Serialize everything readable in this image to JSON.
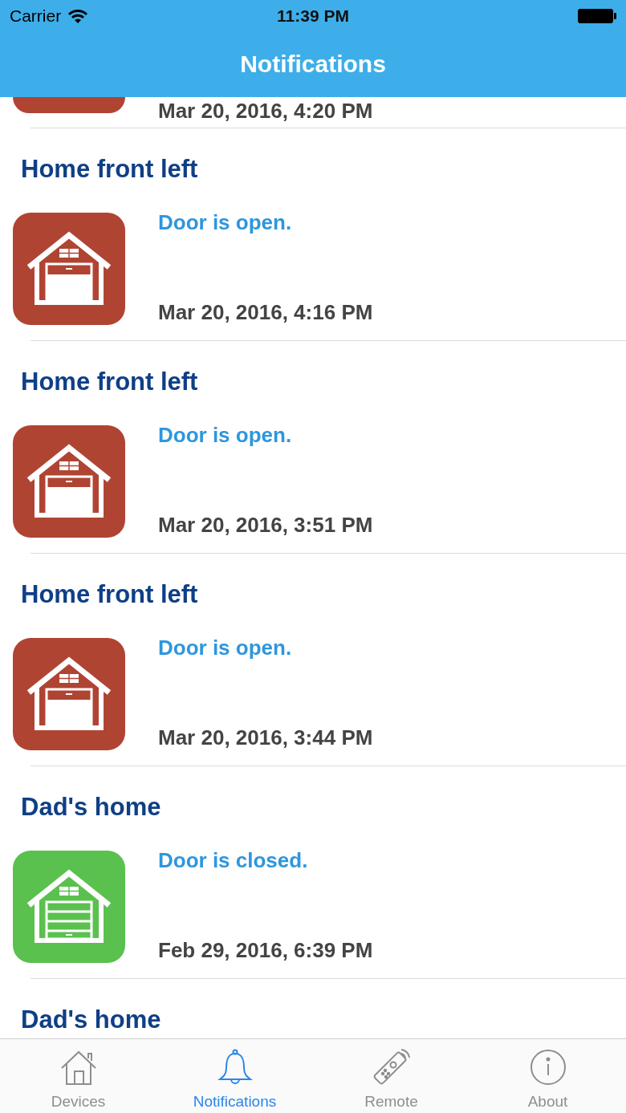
{
  "status_bar": {
    "carrier": "Carrier",
    "time": "11:39 PM"
  },
  "nav_bar": {
    "title": "Notifications"
  },
  "partial_item": {
    "date": "Mar 20, 2016, 4:20 PM",
    "door_open": true
  },
  "notifications": [
    {
      "title": "Home front left",
      "message": "Door is open.",
      "date": "Mar 20, 2016, 4:16 PM",
      "door_open": true
    },
    {
      "title": "Home front left",
      "message": "Door is open.",
      "date": "Mar 20, 2016, 3:51 PM",
      "door_open": true
    },
    {
      "title": "Home front left",
      "message": "Door is open.",
      "date": "Mar 20, 2016, 3:44 PM",
      "door_open": true
    },
    {
      "title": "Dad's home",
      "message": "Door is closed.",
      "date": "Feb 29, 2016, 6:39 PM",
      "door_open": false
    },
    {
      "title": "Dad's home"
    }
  ],
  "tabs": [
    {
      "label": "Devices",
      "kind": "house",
      "selected": false
    },
    {
      "label": "Notifications",
      "kind": "bell",
      "selected": true
    },
    {
      "label": "Remote",
      "kind": "remote",
      "selected": false
    },
    {
      "label": "About",
      "kind": "info",
      "selected": false
    }
  ]
}
